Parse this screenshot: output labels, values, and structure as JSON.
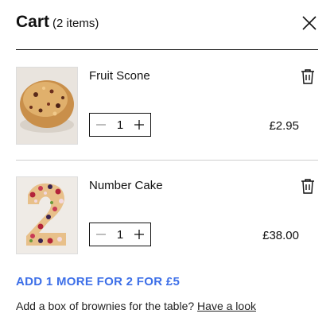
{
  "cart": {
    "title": "Cart",
    "count_label": "(2 items)"
  },
  "items": [
    {
      "name": "Fruit Scone",
      "quantity": "1",
      "price": "£2.95",
      "image_icon": "scone-image"
    },
    {
      "name": "Number Cake",
      "quantity": "1",
      "price": "£38.00",
      "image_icon": "number-cake-image"
    }
  ],
  "promo": {
    "label": "ADD 1 MORE FOR 2 FOR £5",
    "color": "#3d6fe8"
  },
  "upsell": {
    "text": "Add a box of brownies for the table?",
    "link": "Have a look"
  },
  "icons": {
    "close": "close-icon",
    "trash": "trash-icon",
    "minus": "minus-icon",
    "plus": "plus-icon"
  }
}
